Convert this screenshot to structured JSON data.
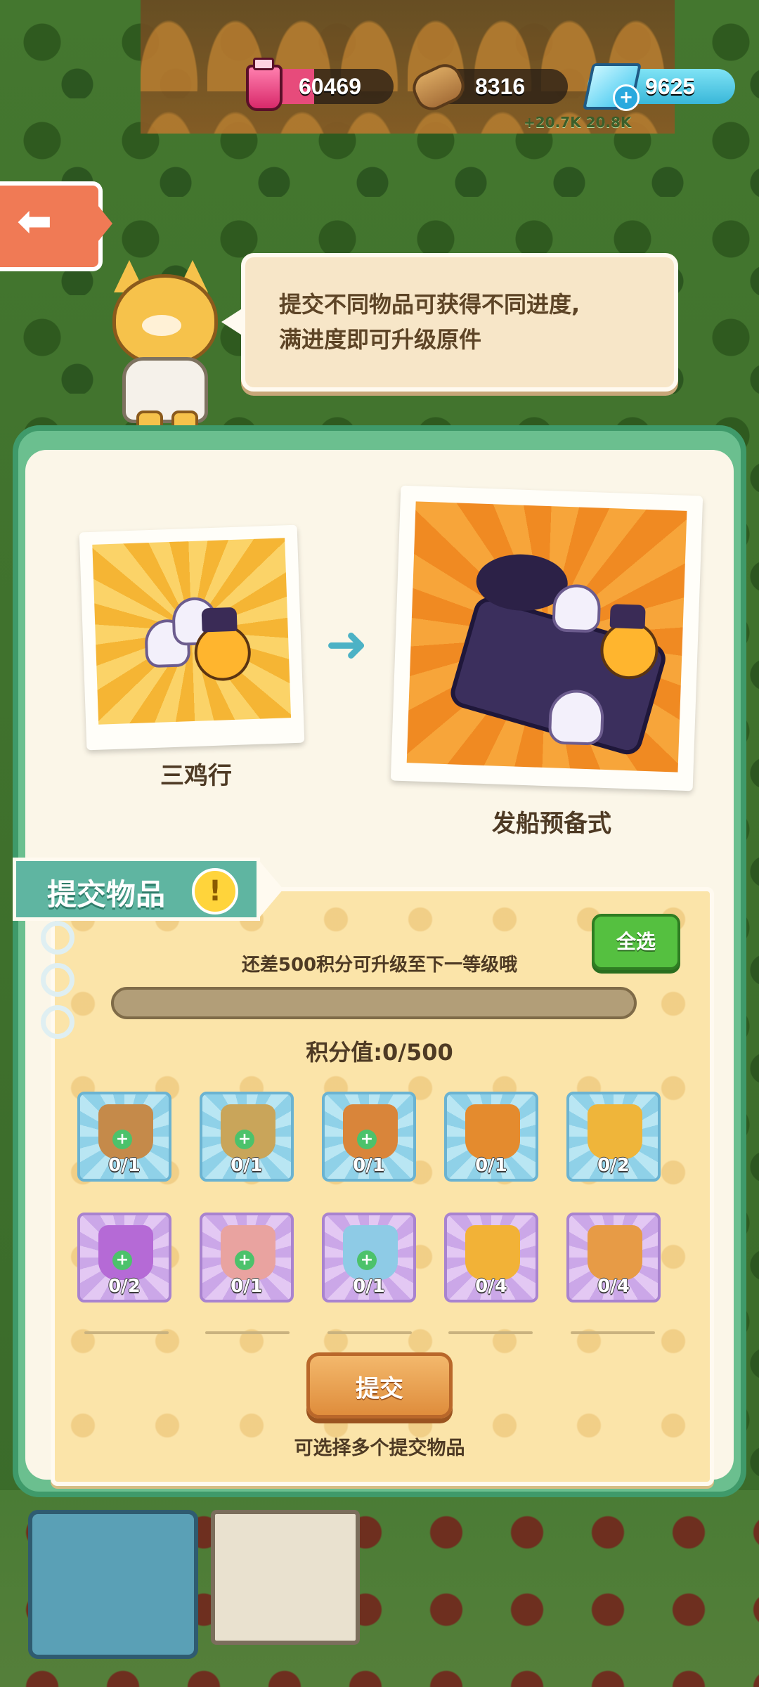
{
  "resources": {
    "potion": {
      "value": "60469",
      "color": "#e74b7b"
    },
    "wood": {
      "value": "8316"
    },
    "gem": {
      "value": "9625",
      "color": "#39b7d9"
    },
    "production": "+20.7K 20.8K"
  },
  "mascot": {
    "speech": [
      "提交不同物品可获得不同进度,",
      "满进度即可升级原件"
    ]
  },
  "upgrade": {
    "current": {
      "name": "三鸡行"
    },
    "next": {
      "name": "发船预备式"
    }
  },
  "submit": {
    "title": "提交物品",
    "warn_symbol": "!",
    "select_all": "全选",
    "hint": "还差500积分可升级至下一等级哦",
    "progress": 0,
    "score_label": "积分值:",
    "score_value": "0/500",
    "items": [
      {
        "name": "milk-tea-icon",
        "count": "0/1",
        "bg": "blue",
        "color": "#c58a4a"
      },
      {
        "name": "matcha-tea-icon",
        "count": "0/1",
        "bg": "blue",
        "color": "#c9a55a"
      },
      {
        "name": "bubble-tea-icon",
        "count": "0/1",
        "bg": "blue",
        "color": "#d9853a"
      },
      {
        "name": "croissant-duo-icon",
        "count": "0/1",
        "bg": "blue",
        "color": "#e48b2e"
      },
      {
        "name": "croissant-icon",
        "count": "0/2",
        "bg": "blue",
        "color": "#efb53a"
      },
      {
        "name": "grape-tea-icon",
        "count": "0/2",
        "bg": "purple",
        "color": "#b56ad6"
      },
      {
        "name": "grapefruit-smoothie-icon",
        "count": "0/1",
        "bg": "purple",
        "color": "#e9a3a0"
      },
      {
        "name": "fruit-parfait-icon",
        "count": "0/1",
        "bg": "purple",
        "color": "#8ecbe6"
      },
      {
        "name": "melon-bun-icon",
        "count": "0/4",
        "bg": "purple",
        "color": "#f2b237"
      },
      {
        "name": "fruit-tart-icon",
        "count": "0/4",
        "bg": "purple",
        "color": "#e79b46"
      }
    ],
    "submit_label": "提交",
    "footnote": "可选择多个提交物品"
  }
}
